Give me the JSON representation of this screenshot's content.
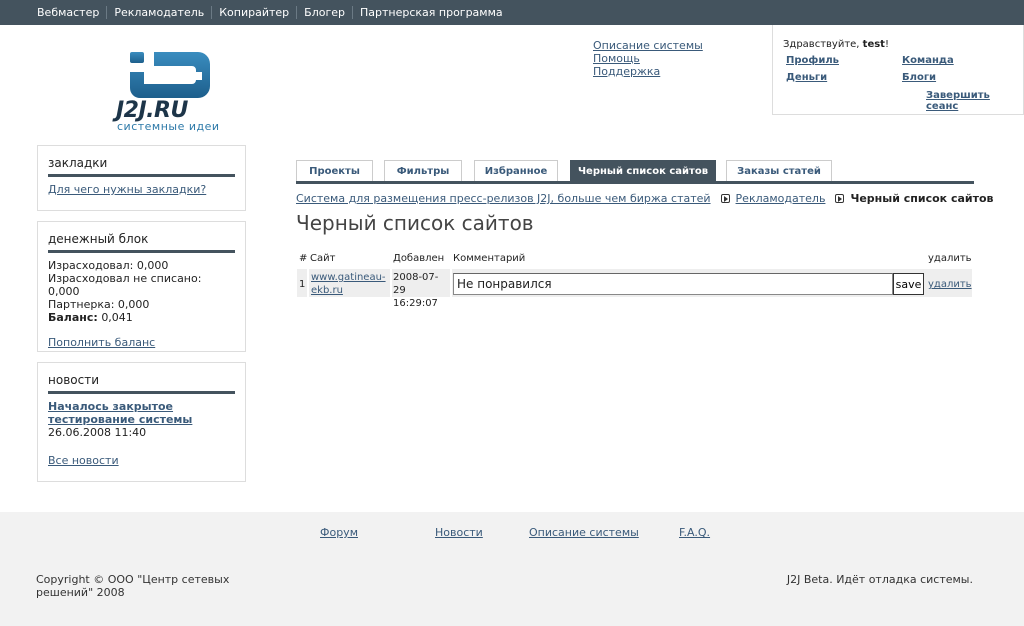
{
  "topnav": [
    "Вебмастер",
    "Рекламодатель",
    "Копирайтер",
    "Блогер",
    "Партнерская программа"
  ],
  "logo": {
    "brand": "J2J.RU",
    "tagline": "системные идеи"
  },
  "toplinks": [
    "Описание системы",
    "Помощь",
    "Поддержка"
  ],
  "user": {
    "greeting": "Здравствуйте,",
    "username": "test",
    "links": {
      "profile": "Профиль",
      "team": "Команда",
      "money": "Деньги",
      "blogs": "Блоги",
      "logout": "Завершить сеанс"
    }
  },
  "bookmarks": {
    "title": "закладки",
    "link": "Для чего нужны закладки?"
  },
  "money": {
    "title": "денежный блок",
    "spent": "Израсходовал: 0,000",
    "spent_unwritten": "Израсходовал не списано: 0,000",
    "partner": "Партнерка: 0,000",
    "balance_label": "Баланс:",
    "balance_value": "0,041",
    "topup": "Пополнить баланс"
  },
  "news": {
    "title": "новости",
    "headline": "Началось закрытое тестирование системы",
    "date": "26.06.2008 11:40",
    "all": "Все новости"
  },
  "tabs": [
    "Проекты",
    "Фильтры",
    "Избранное",
    "Черный список сайтов",
    "Заказы статей"
  ],
  "active_tab": 3,
  "breadcrumb": {
    "root": "Система для размещения пресс-релизов J2J, больше чем биржа статей",
    "section": "Рекламодатель",
    "current": "Черный список сайтов"
  },
  "page_title": "Черный список сайтов",
  "table": {
    "headers": {
      "num": "#",
      "site": "Сайт",
      "added": "Добавлен",
      "comment": "Комментарий",
      "delete": "удалить"
    },
    "rows": [
      {
        "num": "1",
        "site_line1": "www.gatineau-",
        "site_line2": "ekb.ru",
        "date": "2008-07-29",
        "time": "16:29:07",
        "comment": "Не понравился",
        "save": "save",
        "delete": "удалить"
      }
    ]
  },
  "footer": {
    "links": [
      "Форум",
      "Новости",
      "Описание системы",
      "F.A.Q."
    ],
    "copyright": "Copyright © ООО \"Центр сетевых решений\" 2008",
    "status": "J2J Beta. Идёт отладка системы."
  },
  "colors": {
    "topbar": "#44535e",
    "link": "#3a5a7a",
    "logo_dark": "#1d3549",
    "logo_blue": "#2d79a8",
    "footer_bg": "#f2f2f2"
  }
}
